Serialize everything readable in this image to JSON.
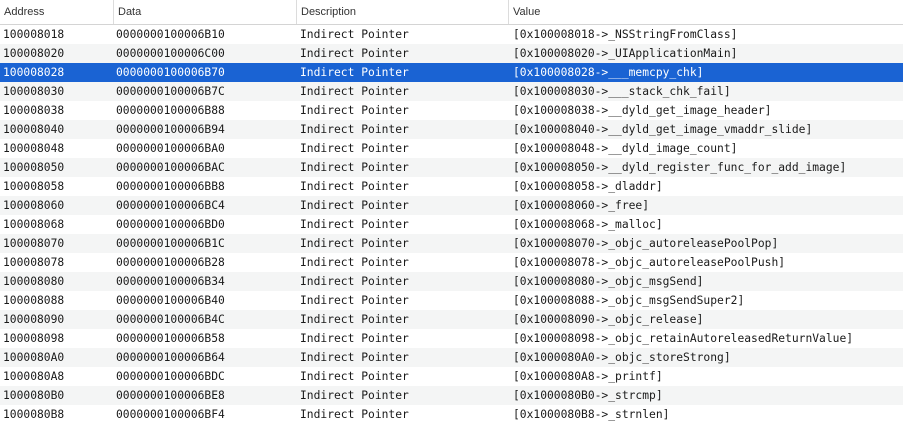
{
  "columns": [
    "Address",
    "Data",
    "Description",
    "Value"
  ],
  "selected_index": 2,
  "rows": [
    {
      "address": "100008018",
      "data": "0000000100006B10",
      "description": "Indirect Pointer",
      "value": "[0x100008018->_NSStringFromClass]"
    },
    {
      "address": "100008020",
      "data": "0000000100006C00",
      "description": "Indirect Pointer",
      "value": "[0x100008020->_UIApplicationMain]"
    },
    {
      "address": "100008028",
      "data": "0000000100006B70",
      "description": "Indirect Pointer",
      "value": "[0x100008028->___memcpy_chk]"
    },
    {
      "address": "100008030",
      "data": "0000000100006B7C",
      "description": "Indirect Pointer",
      "value": "[0x100008030->___stack_chk_fail]"
    },
    {
      "address": "100008038",
      "data": "0000000100006B88",
      "description": "Indirect Pointer",
      "value": "[0x100008038->__dyld_get_image_header]"
    },
    {
      "address": "100008040",
      "data": "0000000100006B94",
      "description": "Indirect Pointer",
      "value": "[0x100008040->__dyld_get_image_vmaddr_slide]"
    },
    {
      "address": "100008048",
      "data": "0000000100006BA0",
      "description": "Indirect Pointer",
      "value": "[0x100008048->__dyld_image_count]"
    },
    {
      "address": "100008050",
      "data": "0000000100006BAC",
      "description": "Indirect Pointer",
      "value": "[0x100008050->__dyld_register_func_for_add_image]"
    },
    {
      "address": "100008058",
      "data": "0000000100006BB8",
      "description": "Indirect Pointer",
      "value": "[0x100008058->_dladdr]"
    },
    {
      "address": "100008060",
      "data": "0000000100006BC4",
      "description": "Indirect Pointer",
      "value": "[0x100008060->_free]"
    },
    {
      "address": "100008068",
      "data": "0000000100006BD0",
      "description": "Indirect Pointer",
      "value": "[0x100008068->_malloc]"
    },
    {
      "address": "100008070",
      "data": "0000000100006B1C",
      "description": "Indirect Pointer",
      "value": "[0x100008070->_objc_autoreleasePoolPop]"
    },
    {
      "address": "100008078",
      "data": "0000000100006B28",
      "description": "Indirect Pointer",
      "value": "[0x100008078->_objc_autoreleasePoolPush]"
    },
    {
      "address": "100008080",
      "data": "0000000100006B34",
      "description": "Indirect Pointer",
      "value": "[0x100008080->_objc_msgSend]"
    },
    {
      "address": "100008088",
      "data": "0000000100006B40",
      "description": "Indirect Pointer",
      "value": "[0x100008088->_objc_msgSendSuper2]"
    },
    {
      "address": "100008090",
      "data": "0000000100006B4C",
      "description": "Indirect Pointer",
      "value": "[0x100008090->_objc_release]"
    },
    {
      "address": "100008098",
      "data": "0000000100006B58",
      "description": "Indirect Pointer",
      "value": "[0x100008098->_objc_retainAutoreleasedReturnValue]"
    },
    {
      "address": "1000080A0",
      "data": "0000000100006B64",
      "description": "Indirect Pointer",
      "value": "[0x1000080A0->_objc_storeStrong]"
    },
    {
      "address": "1000080A8",
      "data": "0000000100006BDC",
      "description": "Indirect Pointer",
      "value": "[0x1000080A8->_printf]"
    },
    {
      "address": "1000080B0",
      "data": "0000000100006BE8",
      "description": "Indirect Pointer",
      "value": "[0x1000080B0->_strcmp]"
    },
    {
      "address": "1000080B8",
      "data": "0000000100006BF4",
      "description": "Indirect Pointer",
      "value": "[0x1000080B8->_strnlen]"
    }
  ],
  "colors": {
    "selection": "#1a63d3",
    "alt_row": "#f4f5f5",
    "header_border": "#d4d4d4"
  }
}
